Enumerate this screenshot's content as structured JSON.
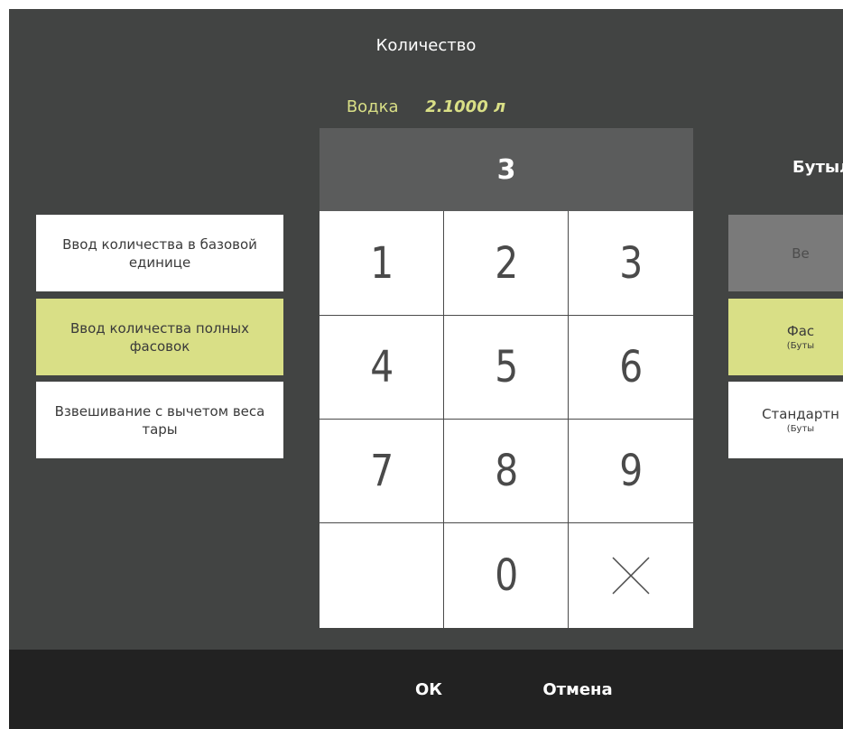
{
  "dialog": {
    "title": "Количество",
    "product_name": "Водка",
    "product_amount": "2.1000 л",
    "display_value": "3"
  },
  "modes": [
    {
      "label": "Ввод количества в базовой единице",
      "active": false
    },
    {
      "label": "Ввод количества полных фасовок",
      "active": true
    },
    {
      "label": "Взвешивание с вычетом веса тары",
      "active": false
    }
  ],
  "keypad": [
    "1",
    "2",
    "3",
    "4",
    "5",
    "6",
    "7",
    "8",
    "9",
    "",
    "0",
    "×"
  ],
  "packaging": {
    "title": "Бутыл",
    "items": [
      {
        "label": "Ве",
        "sub": "",
        "style": "gray"
      },
      {
        "label": "Фас",
        "sub": "(Буты",
        "style": "active"
      },
      {
        "label": "Стандартн",
        "sub": "(Буты",
        "style": "normal"
      }
    ]
  },
  "footer": {
    "ok_label": "ОК",
    "cancel_label": "Отмена"
  },
  "colors": {
    "dialog_bg": "#424443",
    "accent": "#d9df86",
    "display_bg": "#5b5c5c",
    "footer_bg": "#222222"
  }
}
